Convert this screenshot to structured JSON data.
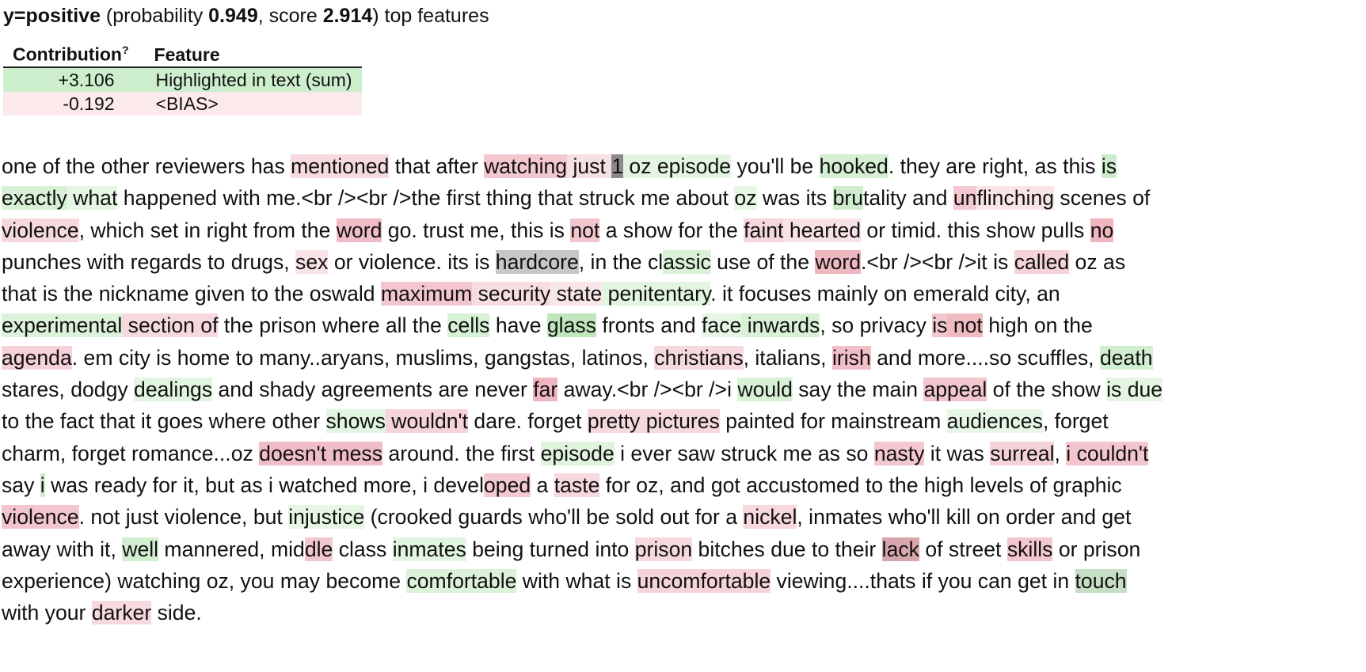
{
  "header": {
    "label": "y=positive",
    "prob_prefix": " (probability ",
    "probability": "0.949",
    "score_prefix": ", score ",
    "score": "2.914",
    "suffix": ") top features"
  },
  "table": {
    "col_contribution": "Contribution",
    "help_mark": "?",
    "col_feature": "Feature",
    "rows": [
      {
        "contribution": "+3.106",
        "feature": "Highlighted in text (sum)",
        "color": "#cdeecd"
      },
      {
        "contribution": "-0.192",
        "feature": "<BIAS>",
        "color": "#fbe9ec"
      }
    ]
  },
  "text_lines": [
    [
      [
        "one of the other reviewers has ",
        ""
      ],
      [
        "mentioned",
        "#f6dadf"
      ],
      [
        " that after ",
        ""
      ],
      [
        "watching",
        "#f3c7ce"
      ],
      [
        " just ",
        "#f7e0e3"
      ],
      [
        "1",
        "#8a8a8a"
      ],
      [
        " oz episode",
        "#e3f5e1"
      ],
      [
        " you'll be ",
        ""
      ],
      [
        "hooked",
        "#d4efd2"
      ],
      [
        ". they are right, as this ",
        ""
      ],
      [
        "is",
        "#cdeccb"
      ]
    ],
    [
      [
        "exactly",
        "#d8f1d6"
      ],
      [
        " what",
        "#e6f6e5"
      ],
      [
        " happened with me.<br /><br />the first thing that struck me about ",
        ""
      ],
      [
        "oz",
        "#e8f7e6"
      ],
      [
        " was its ",
        ""
      ],
      [
        "bru",
        "#cfedcd"
      ],
      [
        "tality and ",
        ""
      ],
      [
        "un",
        "#f3c9cf"
      ],
      [
        "flinching",
        "#f9e4e7"
      ],
      [
        " scenes of",
        ""
      ]
    ],
    [
      [
        "violence",
        "#f6d9de"
      ],
      [
        ", which set in right from the ",
        ""
      ],
      [
        "word",
        "#f0bcc5"
      ],
      [
        " go. trust me, this is ",
        ""
      ],
      [
        "not",
        "#f3c6cd"
      ],
      [
        " a show for the ",
        ""
      ],
      [
        "faint",
        "#f6d7dc"
      ],
      [
        " hearted",
        "#f8e2e5"
      ],
      [
        " or timid. this show pulls ",
        ""
      ],
      [
        "no",
        "#efb6bf"
      ]
    ],
    [
      [
        "punches with regards to drugs, ",
        ""
      ],
      [
        "sex",
        "#f9e3e6"
      ],
      [
        " or violence. its is ",
        ""
      ],
      [
        "hardcore",
        "#c7c7c7"
      ],
      [
        ", in the cl",
        ""
      ],
      [
        "assic",
        "#d9f2d7"
      ],
      [
        " use of the ",
        ""
      ],
      [
        "word",
        "#efb7c0"
      ],
      [
        ".<br /><br />it is ",
        ""
      ],
      [
        "called",
        "#f5d3d8"
      ],
      [
        " oz as",
        ""
      ]
    ],
    [
      [
        "that is the nickname given to the oswald ",
        ""
      ],
      [
        "maximum",
        "#f3c6cd"
      ],
      [
        " security",
        "#f7dde1"
      ],
      [
        " state",
        "#f9e6e8"
      ],
      [
        " penitentary",
        "#e2f5e0"
      ],
      [
        ". it focuses mainly on emerald city, an",
        ""
      ]
    ],
    [
      [
        "experimental",
        "#dcf2da"
      ],
      [
        " section of",
        "#f6d9de"
      ],
      [
        " the prison where all the ",
        ""
      ],
      [
        "cells",
        "#d7f1d5"
      ],
      [
        " have ",
        ""
      ],
      [
        "glass",
        "#bfe6bc"
      ],
      [
        " fronts and ",
        ""
      ],
      [
        "face",
        "#e6f6e5"
      ],
      [
        " inwards",
        "#d8f1d6"
      ],
      [
        ", so privacy ",
        ""
      ],
      [
        "is",
        "#f3c7ce"
      ],
      [
        " not",
        "#f0bac3"
      ],
      [
        " high on the",
        ""
      ]
    ],
    [
      [
        "agenda",
        "#f5d2d8"
      ],
      [
        ". em city is home to many..aryans, muslims, gangstas, latinos, ",
        ""
      ],
      [
        "christians",
        "#f6d9de"
      ],
      [
        ", italians, ",
        ""
      ],
      [
        "irish",
        "#f1bfc7"
      ],
      [
        " and more....so scuffles, ",
        ""
      ],
      [
        "death",
        "#d2eed0"
      ]
    ],
    [
      [
        "stares, dodgy ",
        ""
      ],
      [
        "dealings",
        "#e2f5e0"
      ],
      [
        " and shady agreements are never ",
        ""
      ],
      [
        "far",
        "#efb6bf"
      ],
      [
        " away.<br /><br />i ",
        ""
      ],
      [
        "would",
        "#d9f2d7"
      ],
      [
        " say the main ",
        ""
      ],
      [
        "appeal",
        "#f3c6cd"
      ],
      [
        " of the show ",
        ""
      ],
      [
        "is due",
        "#e4f5e2"
      ]
    ],
    [
      [
        "to the fact that it goes where other ",
        ""
      ],
      [
        "shows",
        "#e2f5e0"
      ],
      [
        " wouldn't",
        "#f5d3d8"
      ],
      [
        " dare. forget ",
        ""
      ],
      [
        "pretty pictures",
        "#f6d9de"
      ],
      [
        " painted for mainstream ",
        ""
      ],
      [
        "audiences",
        "#e7f7e6"
      ],
      [
        ", forget",
        ""
      ]
    ],
    [
      [
        "charm, forget romance...oz ",
        ""
      ],
      [
        "doesn't mess",
        "#f0bcc5"
      ],
      [
        " around. the first ",
        ""
      ],
      [
        "episode",
        "#dff3dd"
      ],
      [
        " i ever saw struck me as so ",
        ""
      ],
      [
        "nasty",
        "#f3c7ce"
      ],
      [
        " it was ",
        ""
      ],
      [
        "surreal",
        "#f5d2d8"
      ],
      [
        ", ",
        ""
      ],
      [
        "i couldn't",
        "#f3c6cd"
      ]
    ],
    [
      [
        "say ",
        ""
      ],
      [
        "i",
        "#cfedcd"
      ],
      [
        " was ready for it, but as i watched more, i devel",
        ""
      ],
      [
        "oped",
        "#f3c8cf"
      ],
      [
        " a ",
        ""
      ],
      [
        "taste",
        "#f6d8dd"
      ],
      [
        " for oz, and got accustomed to the high levels of graphic",
        ""
      ]
    ],
    [
      [
        "violence",
        "#f3c6cd"
      ],
      [
        ". not just violence, but ",
        ""
      ],
      [
        "injustice",
        "#e5f6e3"
      ],
      [
        " (crooked guards who'll be sold out for a ",
        ""
      ],
      [
        "nickel",
        "#f6d8dd"
      ],
      [
        ", inmates who'll kill on order and get",
        ""
      ]
    ],
    [
      [
        "away with it, ",
        ""
      ],
      [
        "well",
        "#d3efd1"
      ],
      [
        " mannered, mid",
        ""
      ],
      [
        "dle",
        "#f3c7ce"
      ],
      [
        " class ",
        ""
      ],
      [
        "inmates",
        "#e2f5e0"
      ],
      [
        " being turned into ",
        ""
      ],
      [
        "prison",
        "#f6d9de"
      ],
      [
        " bitches due to their ",
        ""
      ],
      [
        "lack",
        "#d8a6ad"
      ],
      [
        " of street ",
        ""
      ],
      [
        "skills",
        "#f3c7ce"
      ],
      [
        " or prison",
        ""
      ]
    ],
    [
      [
        "experience) watching oz, you may become ",
        ""
      ],
      [
        "comfortable",
        "#dcf2da"
      ],
      [
        " with what is ",
        ""
      ],
      [
        "uncomfortable",
        "#f5d3d8"
      ],
      [
        " viewing....thats if you can get in ",
        ""
      ],
      [
        "touch",
        "#c6dfc4"
      ]
    ],
    [
      [
        "with your ",
        ""
      ],
      [
        "darker",
        "#f6d9de"
      ],
      [
        " side.",
        ""
      ]
    ]
  ]
}
